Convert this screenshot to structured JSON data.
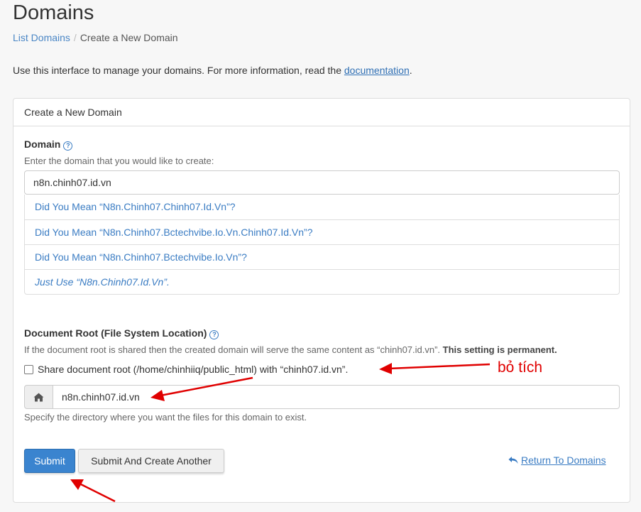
{
  "page": {
    "title": "Domains",
    "breadcrumb": {
      "parent": "List Domains",
      "current": "Create a New Domain"
    },
    "intro_text": "Use this interface to manage your domains. For more information, read the ",
    "intro_link": "documentation",
    "intro_end": "."
  },
  "panel": {
    "heading": "Create a New Domain",
    "domain": {
      "label": "Domain",
      "hint": "Enter the domain that you would like to create:",
      "value": "n8n.chinh07.id.vn",
      "suggestions": [
        "Did You Mean “N8n.Chinh07.Chinh07.Id.Vn”?",
        "Did You Mean “N8n.Chinh07.Bctechvibe.Io.Vn.Chinh07.Id.Vn”?",
        "Did You Mean “N8n.Chinh07.Bctechvibe.Io.Vn”?",
        "Just Use “N8n.Chinh07.Id.Vn”."
      ]
    },
    "docroot": {
      "label": "Document Root (File System Location)",
      "hint": "If the document root is shared then the created domain will serve the same content as “chinh07.id.vn”. ",
      "hint_bold": "This setting is permanent.",
      "share_label": "Share document root (/home/chinhiiq/public_html) with “chinh07.id.vn”.",
      "value": "n8n.chinh07.id.vn",
      "help": "Specify the directory where you want the files for this domain to exist."
    },
    "buttons": {
      "submit": "Submit",
      "submit_another": "Submit And Create Another",
      "return": "Return To Domains"
    }
  },
  "annotation": {
    "text": "bỏ tích",
    "color": "#e00000"
  },
  "colors": {
    "link": "#3a7cc3",
    "primary": "#3a84cf"
  },
  "icons": {
    "help": "question-circle-icon",
    "home": "home-icon",
    "return": "reply-arrow-icon"
  }
}
